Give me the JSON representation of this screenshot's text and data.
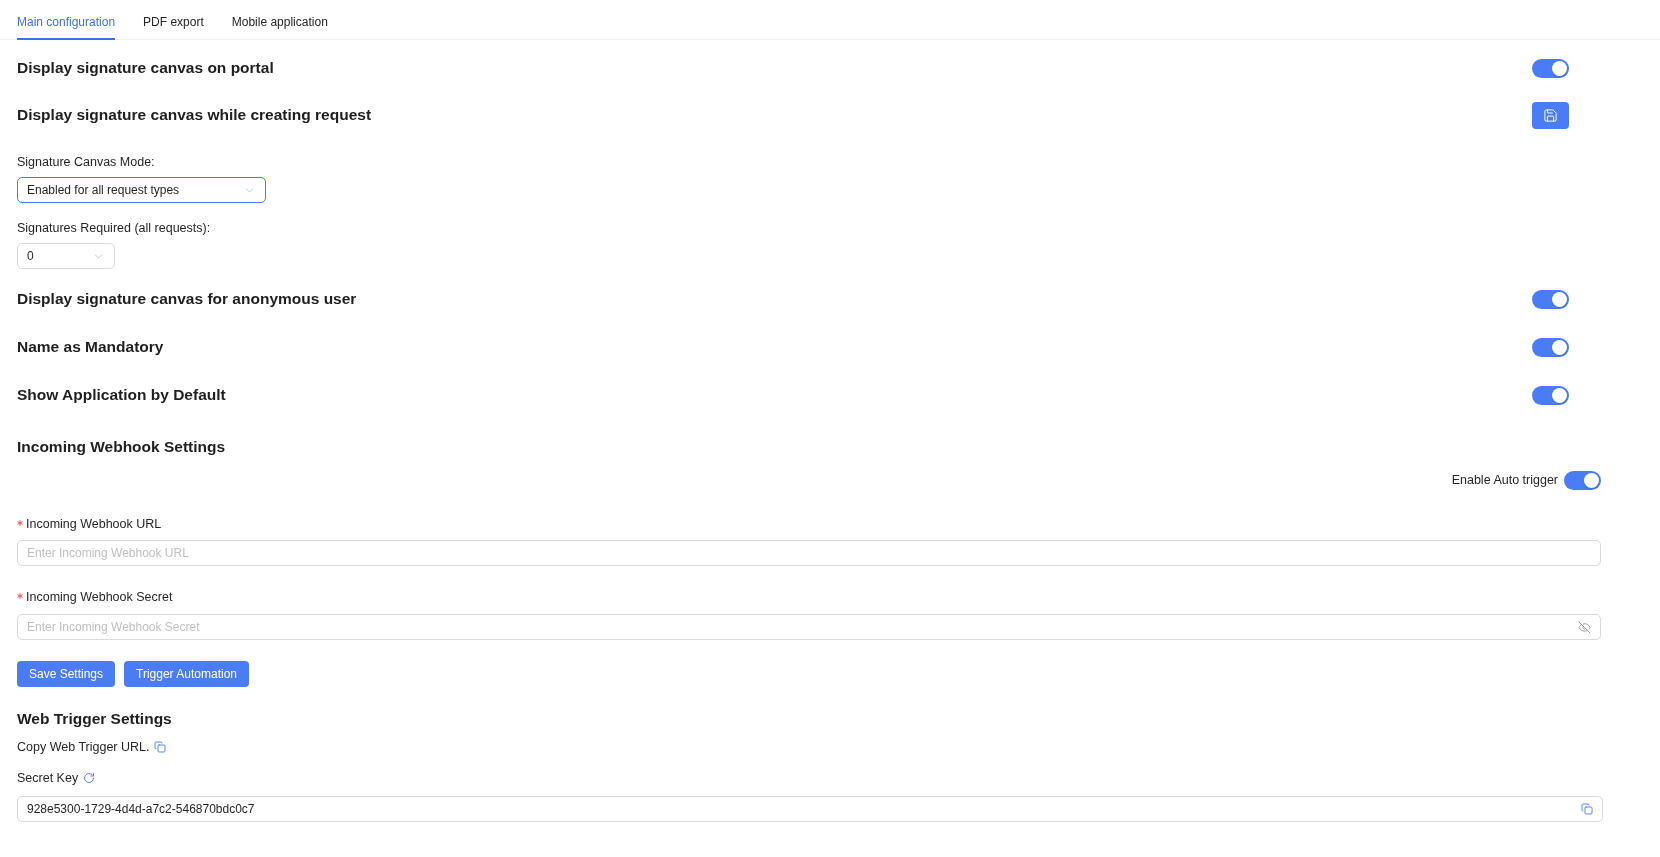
{
  "tabs": [
    {
      "label": "Main configuration",
      "selected": true
    },
    {
      "label": "PDF export",
      "selected": false
    },
    {
      "label": "Mobile application",
      "selected": false
    }
  ],
  "settings": [
    {
      "kind": "toggle",
      "title": "Display signature canvas on portal",
      "on": true
    },
    {
      "kind": "save",
      "title": "Display signature canvas while creating request",
      "fields": [
        {
          "label": "Signature Canvas Mode:",
          "value": "Enabled for all request types",
          "focused": true
        },
        {
          "label": "Signatures Required (all requests):",
          "value": "0",
          "focused": false
        }
      ]
    },
    {
      "kind": "toggle",
      "title": "Display signature canvas for anonymous user",
      "on": true
    },
    {
      "kind": "toggle",
      "title": "Name as Mandatory",
      "on": true
    },
    {
      "kind": "toggle",
      "title": "Show Application by Default",
      "on": true
    }
  ],
  "incoming_webhook": {
    "title": "Incoming Webhook Settings",
    "auto_trigger": {
      "label": "Enable Auto trigger",
      "on": true
    },
    "fields": [
      {
        "kind": "text",
        "label": "Incoming Webhook URL",
        "placeholder": "Enter Incoming Webhook URL",
        "required": true
      },
      {
        "kind": "secret",
        "label": "Incoming Webhook Secret",
        "placeholder": "Enter Incoming Webhook Secret",
        "required": true
      }
    ],
    "buttons": [
      "Save Settings",
      "Trigger Automation"
    ]
  },
  "web_trigger": {
    "title": "Web Trigger Settings",
    "copy_label": "Copy Web Trigger URL.",
    "secret_key_label": "Secret Key",
    "secret_key_value": "928e5300-1729-4d4d-a7c2-546870bdc0c7"
  }
}
